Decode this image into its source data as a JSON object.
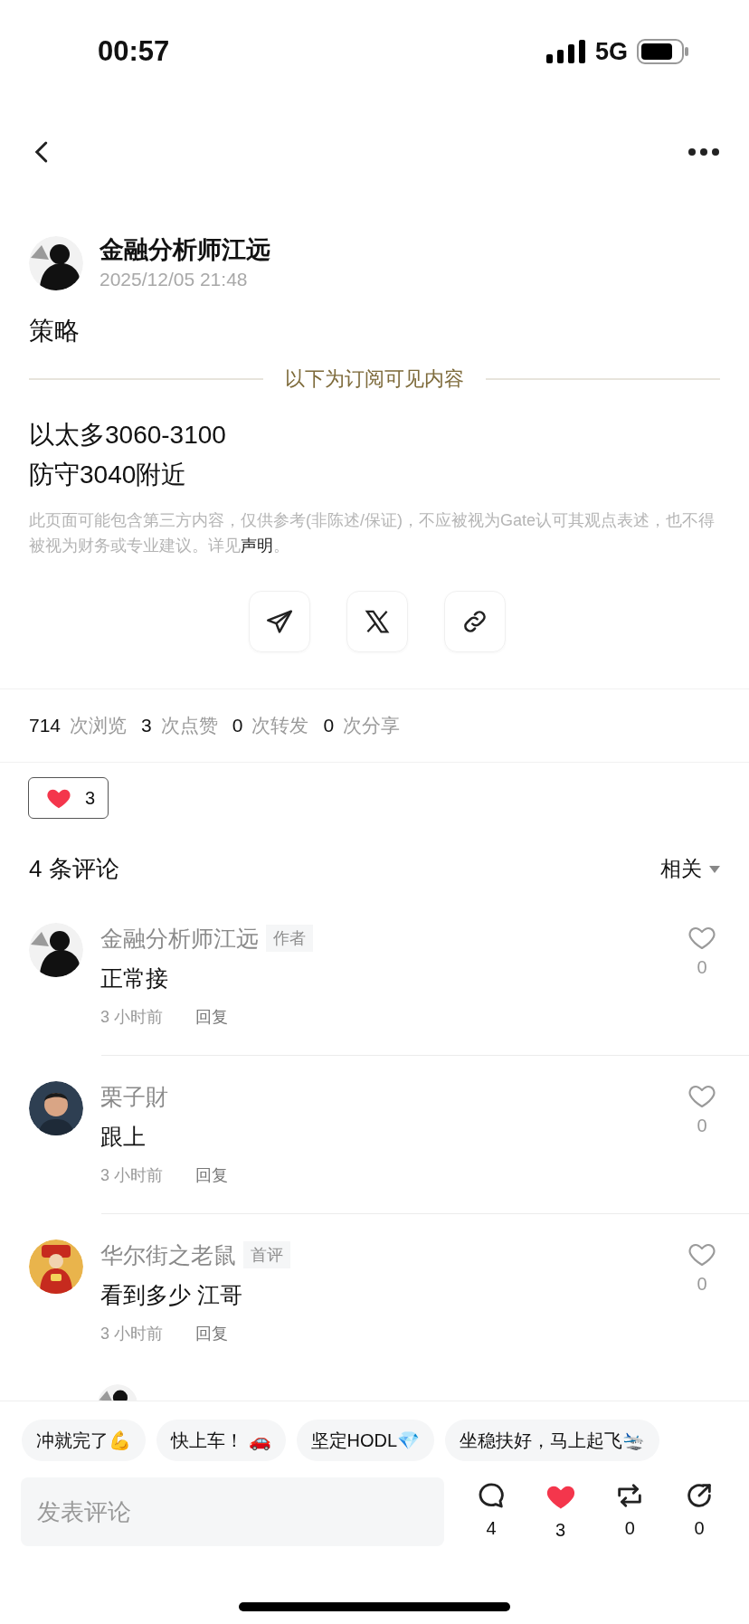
{
  "status_bar": {
    "time": "00:57",
    "network": "5G"
  },
  "post": {
    "author": "金融分析师江远",
    "date": "2025/12/05 21:48",
    "title": "策略",
    "divider_label": "以下为订阅可见内容",
    "lines": [
      "以太多3060-3100",
      "防守3040附近"
    ],
    "disclaimer": "此页面可能包含第三方内容，仅供参考(非陈述/保证)，不应被视为Gate认可其观点表述，也不得被视为财务或专业建议。详见",
    "disclaimer_link": "声明",
    "disclaimer_end": "。"
  },
  "share_buttons": [
    {
      "kind": "telegram"
    },
    {
      "kind": "x"
    },
    {
      "kind": "link"
    }
  ],
  "stats": [
    {
      "count": "714",
      "label": "次浏览"
    },
    {
      "count": "3",
      "label": "次点赞"
    },
    {
      "count": "0",
      "label": "次转发"
    },
    {
      "count": "0",
      "label": "次分享"
    }
  ],
  "reaction": {
    "count": "3",
    "selected": true
  },
  "comments_header": {
    "title": "4 条评论",
    "sort": "相关"
  },
  "comments": [
    {
      "avatar": {
        "kind": "silhouette"
      },
      "name": "金融分析师江远",
      "badge": "作者",
      "text": "正常接",
      "time": "3 小时前",
      "reply": "回复",
      "likes": "0",
      "liked": false
    },
    {
      "avatar": {
        "kind": "person"
      },
      "name": "栗子財",
      "text": "跟上",
      "time": "3 小时前",
      "reply": "回复",
      "likes": "0",
      "liked": false
    },
    {
      "avatar": {
        "kind": "festive"
      },
      "name": "华尔街之老鼠",
      "badge": "首评",
      "text": "看到多少 江哥",
      "time": "3 小时前",
      "reply": "回复",
      "likes": "0",
      "liked": false,
      "replies": [
        {
          "avatar": {
            "kind": "silhouette"
          }
        }
      ]
    }
  ],
  "quick_replies": [
    "冲就完了💪",
    "快上车！ 🚗",
    "坚定HODL💎",
    "坐稳扶好，马上起飞🛬"
  ],
  "comment_input": {
    "placeholder": "发表评论"
  },
  "actions": [
    {
      "kind": "comment",
      "count": "4",
      "selected": false
    },
    {
      "kind": "like",
      "count": "3",
      "selected": true
    },
    {
      "kind": "repost",
      "count": "0",
      "selected": false
    },
    {
      "kind": "share",
      "count": "0",
      "selected": false
    }
  ]
}
